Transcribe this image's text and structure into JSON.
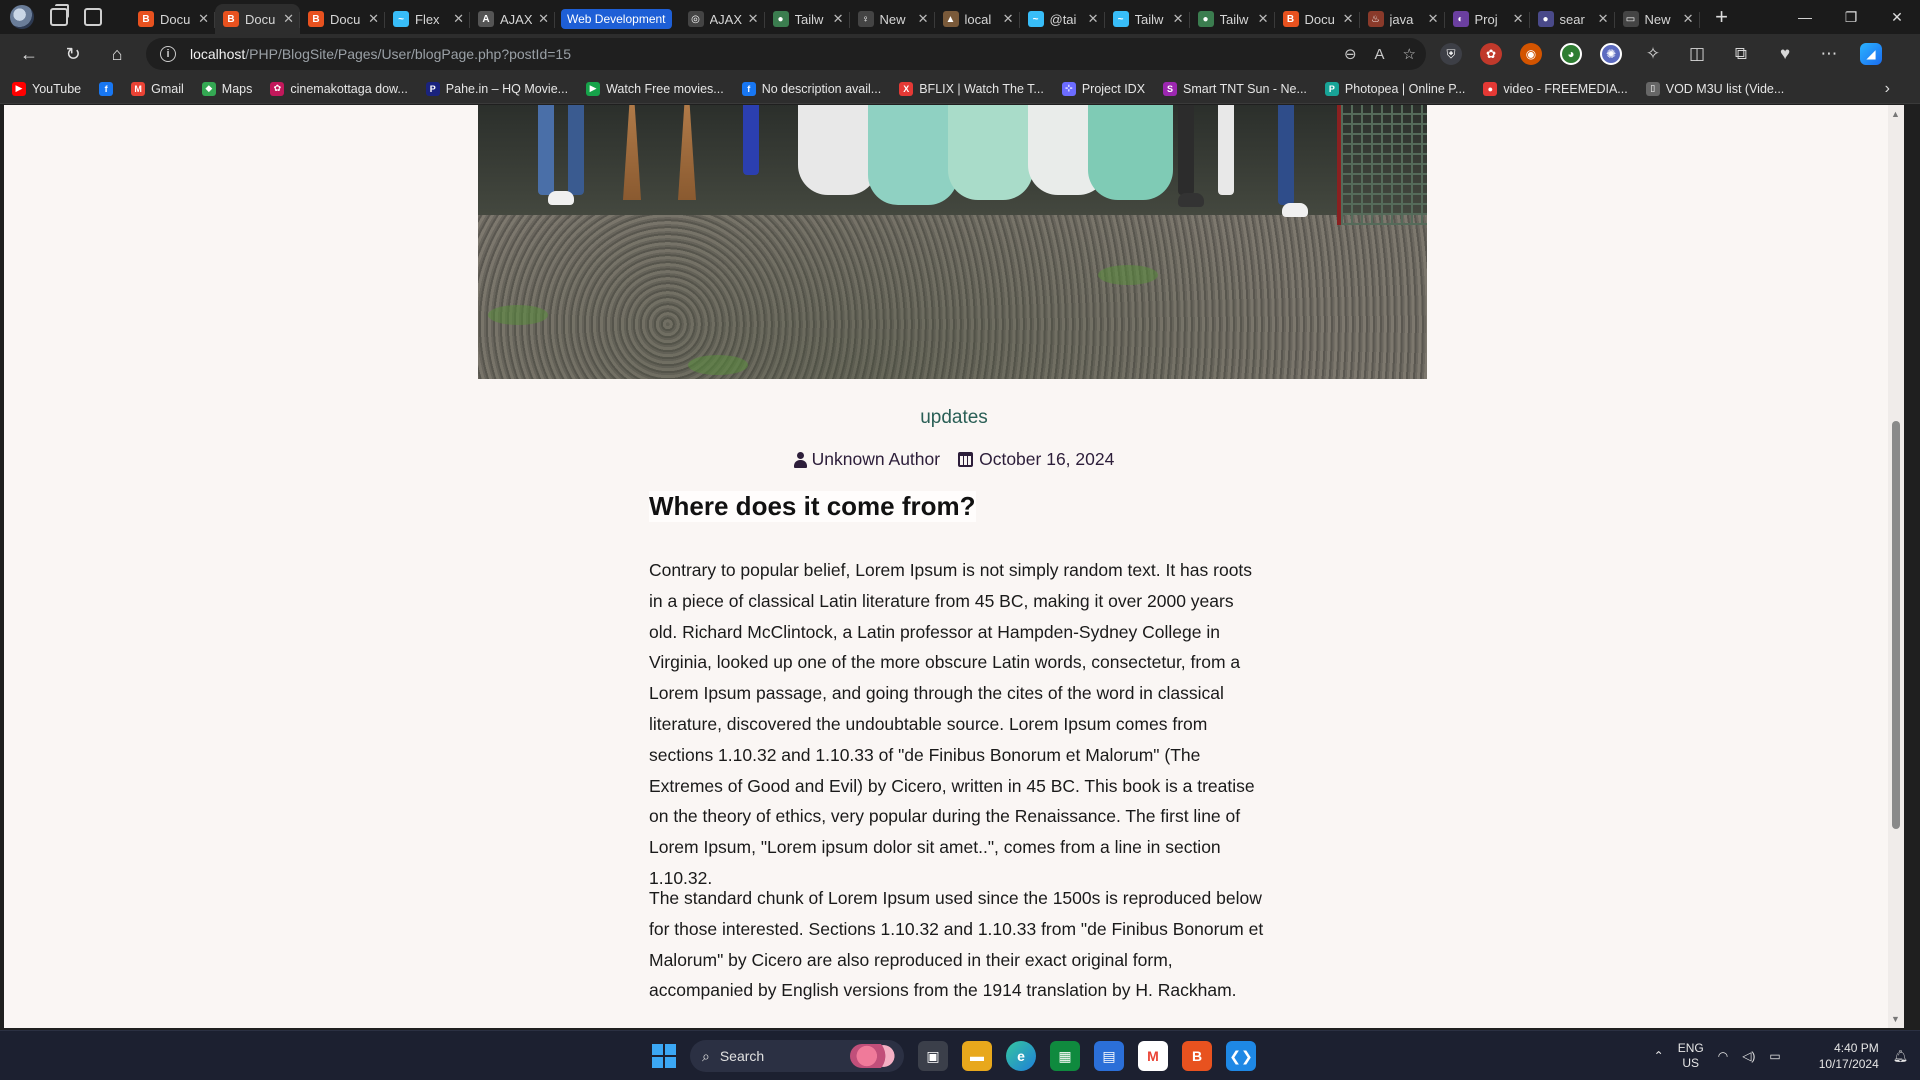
{
  "browser": {
    "tabs": [
      {
        "title": "Docu",
        "fav_color": "#e8521f",
        "fav_glyph": "B",
        "active": false
      },
      {
        "title": "Docu",
        "fav_color": "#e8521f",
        "fav_glyph": "B",
        "active": true
      },
      {
        "title": "Docu",
        "fav_color": "#e8521f",
        "fav_glyph": "B",
        "active": false
      },
      {
        "title": "Flex",
        "fav_color": "#38bdf8",
        "fav_glyph": "~",
        "active": false
      },
      {
        "title": "AJAX",
        "fav_color": "#555555",
        "fav_glyph": "A",
        "active": false
      }
    ],
    "tab_group_label": "Web Development",
    "group_tabs": [
      {
        "title": "AJAX",
        "fav_color": "#444444",
        "fav_glyph": "◎"
      },
      {
        "title": "Tailw",
        "fav_color": "#3b7d4f",
        "fav_glyph": "●"
      },
      {
        "title": "New",
        "fav_color": "#444444",
        "fav_glyph": "♀"
      },
      {
        "title": "local",
        "fav_color": "#7a5a3a",
        "fav_glyph": "▲"
      },
      {
        "title": "@tai",
        "fav_color": "#38bdf8",
        "fav_glyph": "~"
      },
      {
        "title": "Tailw",
        "fav_color": "#38bdf8",
        "fav_glyph": "~"
      },
      {
        "title": "Tailw",
        "fav_color": "#3b7d4f",
        "fav_glyph": "●"
      },
      {
        "title": "Docu",
        "fav_color": "#e8521f",
        "fav_glyph": "B"
      },
      {
        "title": "java",
        "fav_color": "#8a3a2a",
        "fav_glyph": "♨"
      },
      {
        "title": "Proj",
        "fav_color": "#6b3fa0",
        "fav_glyph": "◐"
      },
      {
        "title": "sear",
        "fav_color": "#4a4a8a",
        "fav_glyph": "●"
      },
      {
        "title": "New",
        "fav_color": "#444444",
        "fav_glyph": "▭"
      }
    ],
    "url_host": "localhost",
    "url_path": "/PHP/BlogSite/Pages/User/blogPage.php?postId=15",
    "bookmarks": [
      {
        "label": "YouTube",
        "color": "#ff0000",
        "glyph": "▶"
      },
      {
        "label": "",
        "color": "#1877f2",
        "glyph": "f"
      },
      {
        "label": "Gmail",
        "color": "#ea4335",
        "glyph": "M"
      },
      {
        "label": "Maps",
        "color": "#34a853",
        "glyph": "◆"
      },
      {
        "label": "cinemakottaga dow...",
        "color": "#c2185b",
        "glyph": "✿"
      },
      {
        "label": "Pahe.in – HQ Movie...",
        "color": "#1a237e",
        "glyph": "P"
      },
      {
        "label": "Watch Free movies...",
        "color": "#16a34a",
        "glyph": "▶"
      },
      {
        "label": "No description avail...",
        "color": "#1877f2",
        "glyph": "f"
      },
      {
        "label": "BFLIX | Watch The T...",
        "color": "#e53935",
        "glyph": "X"
      },
      {
        "label": "Project IDX",
        "color": "#6c6cff",
        "glyph": "⊹"
      },
      {
        "label": "Smart TNT Sun - Ne...",
        "color": "#9c27b0",
        "glyph": "S"
      },
      {
        "label": "Photopea | Online P...",
        "color": "#18a497",
        "glyph": "P"
      },
      {
        "label": "video - FREEMEDIA...",
        "color": "#e53935",
        "glyph": "●"
      },
      {
        "label": "VOD M3U list (Vide...",
        "color": "#666666",
        "glyph": "▯"
      }
    ]
  },
  "page": {
    "category": "updates",
    "author": "Unknown Author",
    "date": "October 16, 2024",
    "heading": "Where does it come from?",
    "paragraphs": [
      "Contrary to popular belief, Lorem Ipsum is not simply random text. It has roots in a piece of classical Latin literature from 45 BC, making it over 2000 years old. Richard McClintock, a Latin professor at Hampden-Sydney College in Virginia, looked up one of the more obscure Latin words, consectetur, from a Lorem Ipsum passage, and going through the cites of the word in classical literature, discovered the undoubtable source. Lorem Ipsum comes from sections 1.10.32 and 1.10.33 of \"de Finibus Bonorum et Malorum\" (The Extremes of Good and Evil) by Cicero, written in 45 BC. This book is a treatise on the theory of ethics, very popular during the Renaissance. The first line of Lorem Ipsum, \"Lorem ipsum dolor sit amet..\", comes from a line in section 1.10.32.",
      "The standard chunk of Lorem Ipsum used since the 1500s is reproduced below for those interested. Sections 1.10.32 and 1.10.33 from \"de Finibus Bonorum et Malorum\" by Cicero are also reproduced in their exact original form, accompanied by English versions from the 1914 translation by H. Rackham."
    ]
  },
  "taskbar": {
    "search_placeholder": "Search",
    "lang_line1": "ENG",
    "lang_line2": "US",
    "time": "4:40 PM",
    "date": "10/17/2024"
  }
}
